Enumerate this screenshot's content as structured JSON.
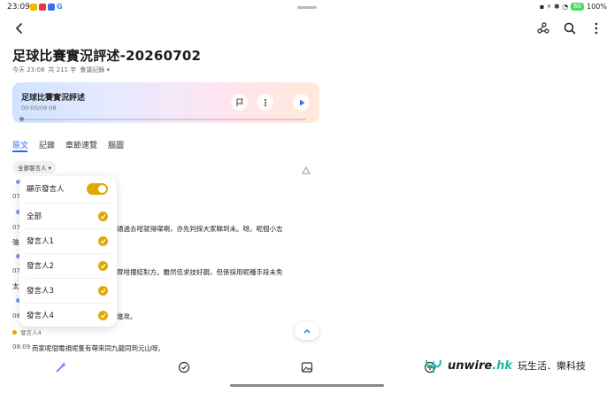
{
  "status": {
    "time": "23:09",
    "battery": "100%",
    "battery_icon": "60"
  },
  "header": {
    "title": "足球比賽實況評述-20260702",
    "meta_date": "今天 23:08",
    "meta_count": "共 211 字",
    "meta_category": "會議記錄 ▾"
  },
  "player": {
    "title": "足球比賽實況評述",
    "time": "00:00/09:08"
  },
  "tabs": [
    {
      "label": "原文",
      "active": true
    },
    {
      "label": "記錄"
    },
    {
      "label": "章節速覽"
    },
    {
      "label": "腦圖"
    }
  ],
  "filter": {
    "label": "全部發言人 ▾"
  },
  "dropdown": {
    "toggle_label": "顯示發言人",
    "options": [
      "全部",
      "發言人1",
      "發言人2",
      "發言人3",
      "發言人4"
    ]
  },
  "transcript": {
    "ts1": "07",
    "ts2": "07",
    "line2": "通過去咁就得㗎喇，亦先判採大家睇到未。呀。呢個小志",
    "line2b": "強",
    "ts3": "07",
    "line3": "齊咁撞結對方。雖然佢求技好靚，但係採用呢種手段未免",
    "line3b": "太",
    "ts4": "08",
    "line4": "進攻。",
    "last_speaker": "發言人4",
    "last_ts": "08:09",
    "last_line": "而家呢個電視呢隻有帶來同九龍同到元山呀。"
  },
  "watermark": {
    "brand": "unwire",
    "suffix": ".hk",
    "partner": "玩生活．樂科技"
  },
  "colors": {
    "accent": "#2962ff",
    "speaker": "#e0a800"
  }
}
